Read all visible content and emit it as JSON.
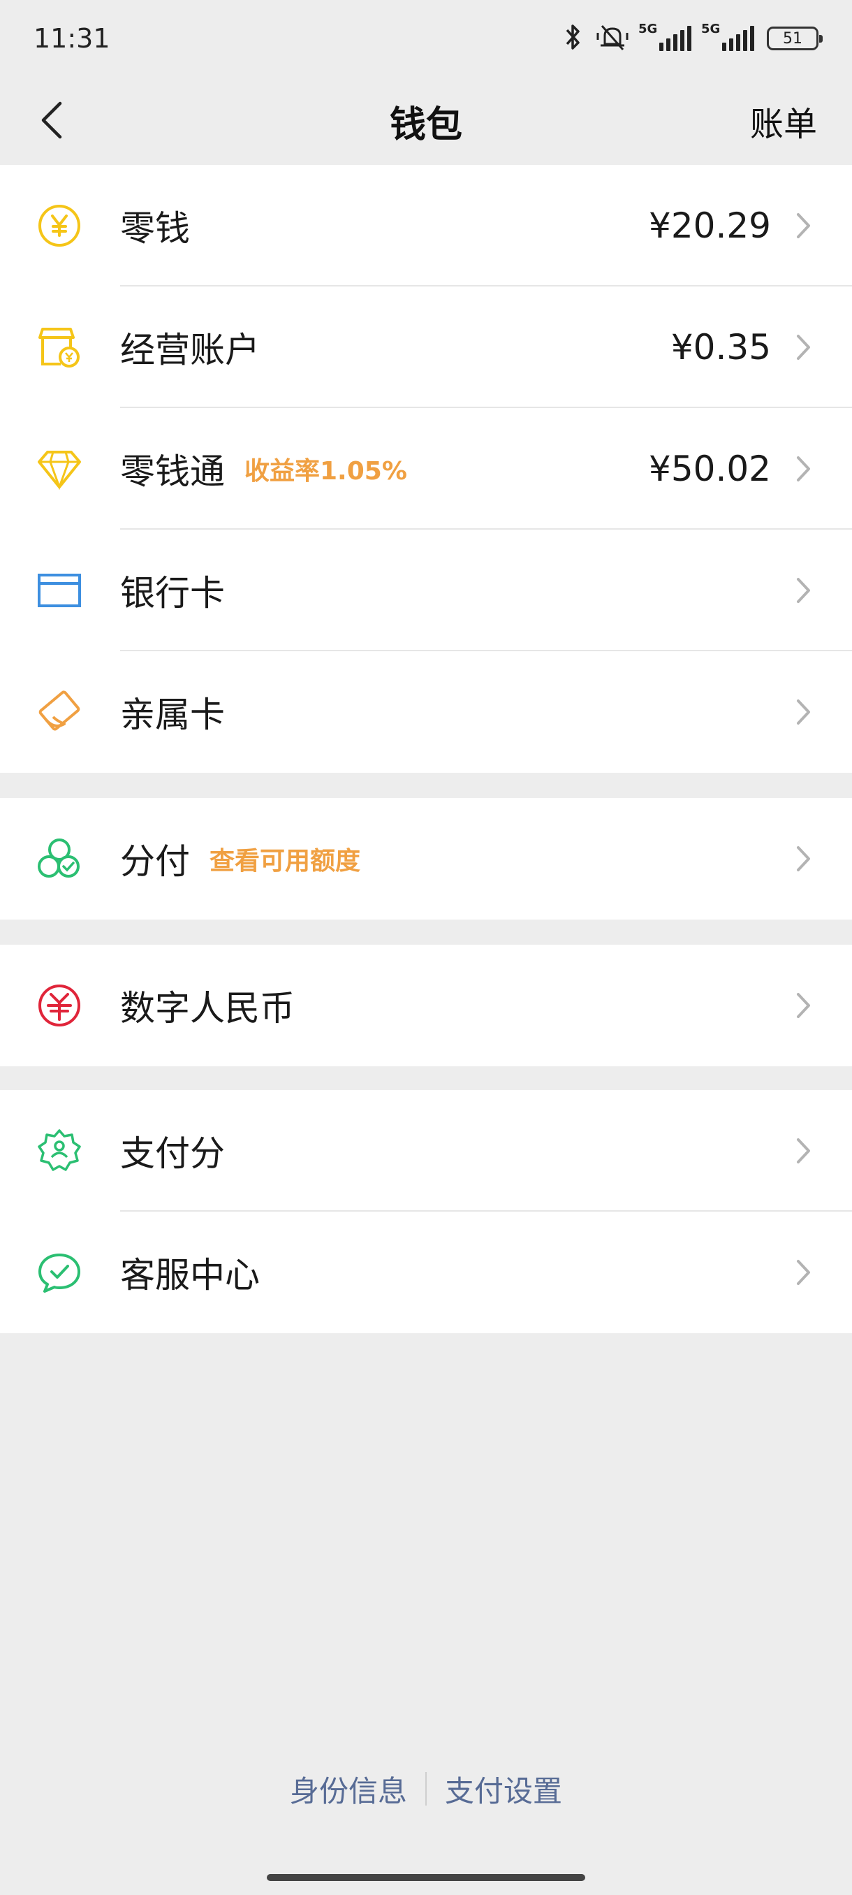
{
  "status_bar": {
    "time": "11:31",
    "network1": "5G",
    "network2": "5G",
    "battery": "51"
  },
  "nav": {
    "title": "钱包",
    "right_label": "账单"
  },
  "groups": [
    {
      "items": [
        {
          "label": "零钱",
          "value": "¥20.29",
          "icon": "coin-icon"
        },
        {
          "label": "经营账户",
          "value": "¥0.35",
          "icon": "shop-account-icon"
        },
        {
          "label": "零钱通",
          "sub": "收益率1.05%",
          "value": "¥50.02",
          "icon": "diamond-icon"
        },
        {
          "label": "银行卡",
          "icon": "bank-card-icon"
        },
        {
          "label": "亲属卡",
          "icon": "family-card-icon"
        }
      ]
    },
    {
      "items": [
        {
          "label": "分付",
          "sub": "查看可用额度",
          "icon": "fenfu-icon"
        }
      ]
    },
    {
      "items": [
        {
          "label": "数字人民币",
          "icon": "digital-rmb-icon"
        }
      ]
    },
    {
      "items": [
        {
          "label": "支付分",
          "icon": "pay-score-icon"
        },
        {
          "label": "客服中心",
          "icon": "customer-service-icon"
        }
      ]
    }
  ],
  "footer": {
    "identity_label": "身份信息",
    "settings_label": "支付设置"
  },
  "colors": {
    "background": "#ededed",
    "card": "#ffffff",
    "accent_orange": "#f0a042",
    "link_blue": "#576b95",
    "yellow": "#f5c518",
    "green": "#2bbf72",
    "blue": "#3d8fe0",
    "red": "#e0253a"
  }
}
